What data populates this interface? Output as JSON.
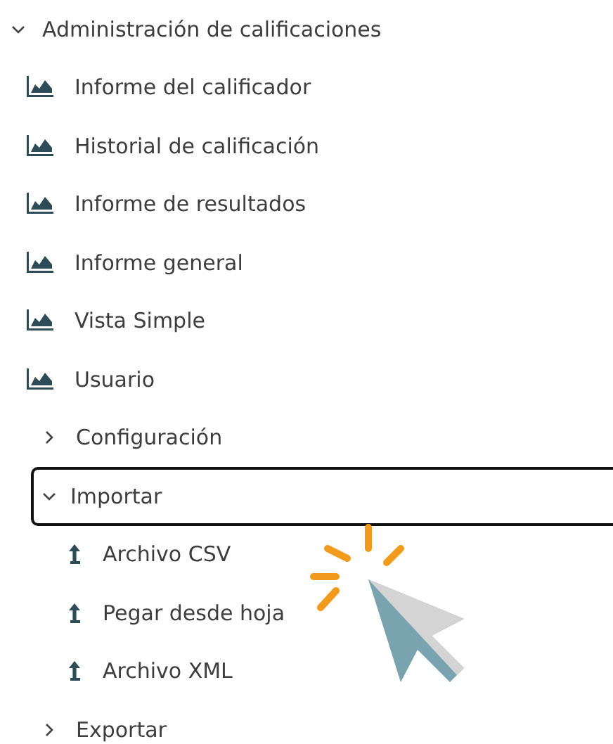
{
  "tree": [
    {
      "label": "Administración de calificaciones",
      "kind": "group",
      "expanded": true,
      "focused": false,
      "children": [
        {
          "label": "Informe del calificador",
          "kind": "report"
        },
        {
          "label": "Historial de calificación",
          "kind": "report"
        },
        {
          "label": "Informe de resultados",
          "kind": "report"
        },
        {
          "label": "Informe general",
          "kind": "report"
        },
        {
          "label": "Vista Simple",
          "kind": "report"
        },
        {
          "label": "Usuario",
          "kind": "report"
        },
        {
          "label": "Configuración",
          "kind": "group",
          "expanded": false,
          "focused": false
        },
        {
          "label": "Importar",
          "kind": "group",
          "expanded": true,
          "focused": true,
          "children": [
            {
              "label": "Archivo CSV",
              "kind": "import"
            },
            {
              "label": "Pegar desde hoja",
              "kind": "import"
            },
            {
              "label": "Archivo XML",
              "kind": "import"
            }
          ]
        },
        {
          "label": "Exportar",
          "kind": "group",
          "expanded": false,
          "focused": false
        }
      ]
    }
  ]
}
